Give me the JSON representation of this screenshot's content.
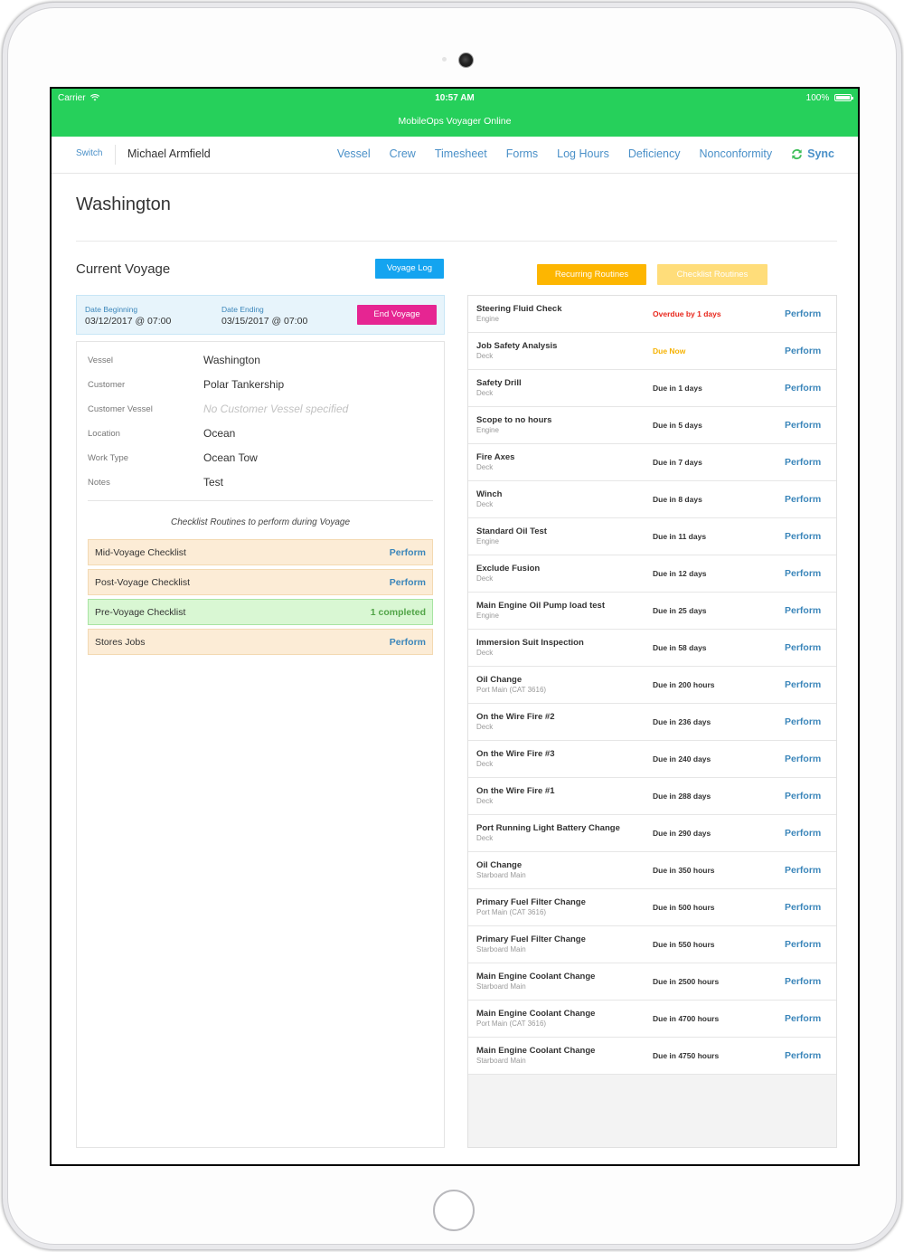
{
  "status_bar": {
    "carrier": "Carrier",
    "time": "10:57 AM",
    "battery": "100%"
  },
  "app": {
    "title": "MobileOps Voyager Online"
  },
  "nav": {
    "switch": "Switch",
    "user": "Michael Armfield",
    "links": [
      "Vessel",
      "Crew",
      "Timesheet",
      "Forms",
      "Log Hours",
      "Deficiency",
      "Nonconformity"
    ],
    "sync": "Sync"
  },
  "vessel": {
    "title": "Washington"
  },
  "voyage": {
    "section_title": "Current Voyage",
    "voyage_log_label": "Voyage Log",
    "date_beginning_label": "Date Beginning",
    "date_beginning": "03/12/2017 @ 07:00",
    "date_ending_label": "Date Ending",
    "date_ending": "03/15/2017 @ 07:00",
    "end_voyage_label": "End Voyage",
    "details": [
      {
        "label": "Vessel",
        "value": "Washington"
      },
      {
        "label": "Customer",
        "value": "Polar Tankership"
      },
      {
        "label": "Customer Vessel",
        "value": "No Customer Vessel specified"
      },
      {
        "label": "Location",
        "value": "Ocean"
      },
      {
        "label": "Work Type",
        "value": "Ocean Tow"
      },
      {
        "label": "Notes",
        "value": "Test"
      }
    ],
    "checklist_caption": "Checklist Routines to perform during Voyage",
    "checklists": [
      {
        "name": "Mid-Voyage Checklist",
        "action": "Perform"
      },
      {
        "name": "Post-Voyage Checklist",
        "action": "Perform"
      },
      {
        "name": "Pre-Voyage Checklist",
        "action": "1 completed"
      },
      {
        "name": "Stores Jobs",
        "action": "Perform"
      }
    ]
  },
  "routines": {
    "recurring_label": "Recurring Routines",
    "checklist_label": "Checklist Routines",
    "items": [
      {
        "name": "Steering Fluid Check",
        "sub": "Engine",
        "due": "Overdue by 1 days",
        "action": "Perform"
      },
      {
        "name": "Job Safety Analysis",
        "sub": "Deck",
        "due": "Due Now",
        "action": "Perform"
      },
      {
        "name": "Safety Drill",
        "sub": "Deck",
        "due": "Due in 1 days",
        "action": "Perform"
      },
      {
        "name": "Scope to no hours",
        "sub": "Engine",
        "due": "Due in 5 days",
        "action": "Perform"
      },
      {
        "name": "Fire Axes",
        "sub": "Deck",
        "due": "Due in 7 days",
        "action": "Perform"
      },
      {
        "name": "Winch",
        "sub": "Deck",
        "due": "Due in 8 days",
        "action": "Perform"
      },
      {
        "name": "Standard Oil Test",
        "sub": "Engine",
        "due": "Due in 11 days",
        "action": "Perform"
      },
      {
        "name": "Exclude Fusion",
        "sub": "Deck",
        "due": "Due in 12 days",
        "action": "Perform"
      },
      {
        "name": "Main Engine Oil Pump load test",
        "sub": "Engine",
        "due": "Due in 25 days",
        "action": "Perform"
      },
      {
        "name": "Immersion Suit Inspection",
        "sub": "Deck",
        "due": "Due in 58 days",
        "action": "Perform"
      },
      {
        "name": "Oil Change",
        "sub": "Port Main (CAT 3616)",
        "due": "Due in 200 hours",
        "action": "Perform"
      },
      {
        "name": "On the Wire Fire #2",
        "sub": "Deck",
        "due": "Due in 236 days",
        "action": "Perform"
      },
      {
        "name": "On the Wire Fire #3",
        "sub": "Deck",
        "due": "Due in 240 days",
        "action": "Perform"
      },
      {
        "name": "On the Wire Fire #1",
        "sub": "Deck",
        "due": "Due in 288 days",
        "action": "Perform"
      },
      {
        "name": "Port Running Light Battery Change",
        "sub": "Deck",
        "due": "Due in 290 days",
        "action": "Perform"
      },
      {
        "name": "Oil Change",
        "sub": "Starboard Main",
        "due": "Due in 350 hours",
        "action": "Perform"
      },
      {
        "name": "Primary Fuel Filter Change",
        "sub": "Port Main (CAT 3616)",
        "due": "Due in 500 hours",
        "action": "Perform"
      },
      {
        "name": "Primary Fuel Filter Change",
        "sub": "Starboard Main",
        "due": "Due in 550 hours",
        "action": "Perform"
      },
      {
        "name": "Main Engine Coolant Change",
        "sub": "Starboard Main",
        "due": "Due in 2500 hours",
        "action": "Perform"
      },
      {
        "name": "Main Engine Coolant Change",
        "sub": "Port Main (CAT 3616)",
        "due": "Due in 4700 hours",
        "action": "Perform"
      },
      {
        "name": "Main Engine Coolant Change",
        "sub": "Starboard Main",
        "due": "Due in 4750 hours",
        "action": "Perform"
      }
    ]
  },
  "colors": {
    "header_green": "#26d05b",
    "link_blue": "#4a90c8",
    "voyage_log_blue": "#14a4f0",
    "end_voyage_pink": "#e62592",
    "recurring_orange": "#fdb601",
    "overdue_red": "#e8271c",
    "due_now_amber": "#f6b201",
    "completed_green": "#52a548"
  }
}
